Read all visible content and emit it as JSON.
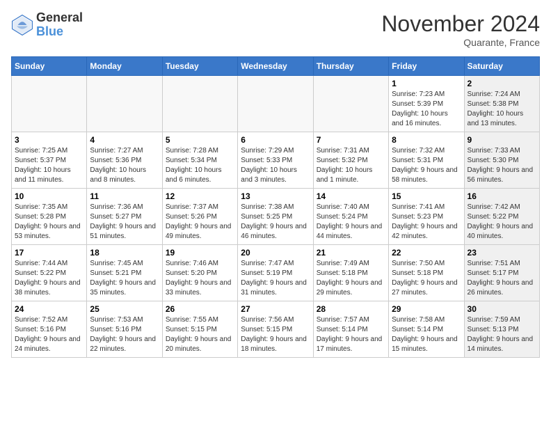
{
  "header": {
    "logo_general": "General",
    "logo_blue": "Blue",
    "month_title": "November 2024",
    "location": "Quarante, France"
  },
  "days_of_week": [
    "Sunday",
    "Monday",
    "Tuesday",
    "Wednesday",
    "Thursday",
    "Friday",
    "Saturday"
  ],
  "weeks": [
    [
      {
        "day": "",
        "info": "",
        "empty": true
      },
      {
        "day": "",
        "info": "",
        "empty": true
      },
      {
        "day": "",
        "info": "",
        "empty": true
      },
      {
        "day": "",
        "info": "",
        "empty": true
      },
      {
        "day": "",
        "info": "",
        "empty": true
      },
      {
        "day": "1",
        "info": "Sunrise: 7:23 AM\nSunset: 5:39 PM\nDaylight: 10 hours and 16 minutes.",
        "shaded": false
      },
      {
        "day": "2",
        "info": "Sunrise: 7:24 AM\nSunset: 5:38 PM\nDaylight: 10 hours and 13 minutes.",
        "shaded": true
      }
    ],
    [
      {
        "day": "3",
        "info": "Sunrise: 7:25 AM\nSunset: 5:37 PM\nDaylight: 10 hours and 11 minutes.",
        "shaded": false
      },
      {
        "day": "4",
        "info": "Sunrise: 7:27 AM\nSunset: 5:36 PM\nDaylight: 10 hours and 8 minutes.",
        "shaded": false
      },
      {
        "day": "5",
        "info": "Sunrise: 7:28 AM\nSunset: 5:34 PM\nDaylight: 10 hours and 6 minutes.",
        "shaded": false
      },
      {
        "day": "6",
        "info": "Sunrise: 7:29 AM\nSunset: 5:33 PM\nDaylight: 10 hours and 3 minutes.",
        "shaded": false
      },
      {
        "day": "7",
        "info": "Sunrise: 7:31 AM\nSunset: 5:32 PM\nDaylight: 10 hours and 1 minute.",
        "shaded": false
      },
      {
        "day": "8",
        "info": "Sunrise: 7:32 AM\nSunset: 5:31 PM\nDaylight: 9 hours and 58 minutes.",
        "shaded": false
      },
      {
        "day": "9",
        "info": "Sunrise: 7:33 AM\nSunset: 5:30 PM\nDaylight: 9 hours and 56 minutes.",
        "shaded": true
      }
    ],
    [
      {
        "day": "10",
        "info": "Sunrise: 7:35 AM\nSunset: 5:28 PM\nDaylight: 9 hours and 53 minutes.",
        "shaded": false
      },
      {
        "day": "11",
        "info": "Sunrise: 7:36 AM\nSunset: 5:27 PM\nDaylight: 9 hours and 51 minutes.",
        "shaded": false
      },
      {
        "day": "12",
        "info": "Sunrise: 7:37 AM\nSunset: 5:26 PM\nDaylight: 9 hours and 49 minutes.",
        "shaded": false
      },
      {
        "day": "13",
        "info": "Sunrise: 7:38 AM\nSunset: 5:25 PM\nDaylight: 9 hours and 46 minutes.",
        "shaded": false
      },
      {
        "day": "14",
        "info": "Sunrise: 7:40 AM\nSunset: 5:24 PM\nDaylight: 9 hours and 44 minutes.",
        "shaded": false
      },
      {
        "day": "15",
        "info": "Sunrise: 7:41 AM\nSunset: 5:23 PM\nDaylight: 9 hours and 42 minutes.",
        "shaded": false
      },
      {
        "day": "16",
        "info": "Sunrise: 7:42 AM\nSunset: 5:22 PM\nDaylight: 9 hours and 40 minutes.",
        "shaded": true
      }
    ],
    [
      {
        "day": "17",
        "info": "Sunrise: 7:44 AM\nSunset: 5:22 PM\nDaylight: 9 hours and 38 minutes.",
        "shaded": false
      },
      {
        "day": "18",
        "info": "Sunrise: 7:45 AM\nSunset: 5:21 PM\nDaylight: 9 hours and 35 minutes.",
        "shaded": false
      },
      {
        "day": "19",
        "info": "Sunrise: 7:46 AM\nSunset: 5:20 PM\nDaylight: 9 hours and 33 minutes.",
        "shaded": false
      },
      {
        "day": "20",
        "info": "Sunrise: 7:47 AM\nSunset: 5:19 PM\nDaylight: 9 hours and 31 minutes.",
        "shaded": false
      },
      {
        "day": "21",
        "info": "Sunrise: 7:49 AM\nSunset: 5:18 PM\nDaylight: 9 hours and 29 minutes.",
        "shaded": false
      },
      {
        "day": "22",
        "info": "Sunrise: 7:50 AM\nSunset: 5:18 PM\nDaylight: 9 hours and 27 minutes.",
        "shaded": false
      },
      {
        "day": "23",
        "info": "Sunrise: 7:51 AM\nSunset: 5:17 PM\nDaylight: 9 hours and 26 minutes.",
        "shaded": true
      }
    ],
    [
      {
        "day": "24",
        "info": "Sunrise: 7:52 AM\nSunset: 5:16 PM\nDaylight: 9 hours and 24 minutes.",
        "shaded": false
      },
      {
        "day": "25",
        "info": "Sunrise: 7:53 AM\nSunset: 5:16 PM\nDaylight: 9 hours and 22 minutes.",
        "shaded": false
      },
      {
        "day": "26",
        "info": "Sunrise: 7:55 AM\nSunset: 5:15 PM\nDaylight: 9 hours and 20 minutes.",
        "shaded": false
      },
      {
        "day": "27",
        "info": "Sunrise: 7:56 AM\nSunset: 5:15 PM\nDaylight: 9 hours and 18 minutes.",
        "shaded": false
      },
      {
        "day": "28",
        "info": "Sunrise: 7:57 AM\nSunset: 5:14 PM\nDaylight: 9 hours and 17 minutes.",
        "shaded": false
      },
      {
        "day": "29",
        "info": "Sunrise: 7:58 AM\nSunset: 5:14 PM\nDaylight: 9 hours and 15 minutes.",
        "shaded": false
      },
      {
        "day": "30",
        "info": "Sunrise: 7:59 AM\nSunset: 5:13 PM\nDaylight: 9 hours and 14 minutes.",
        "shaded": true
      }
    ]
  ]
}
